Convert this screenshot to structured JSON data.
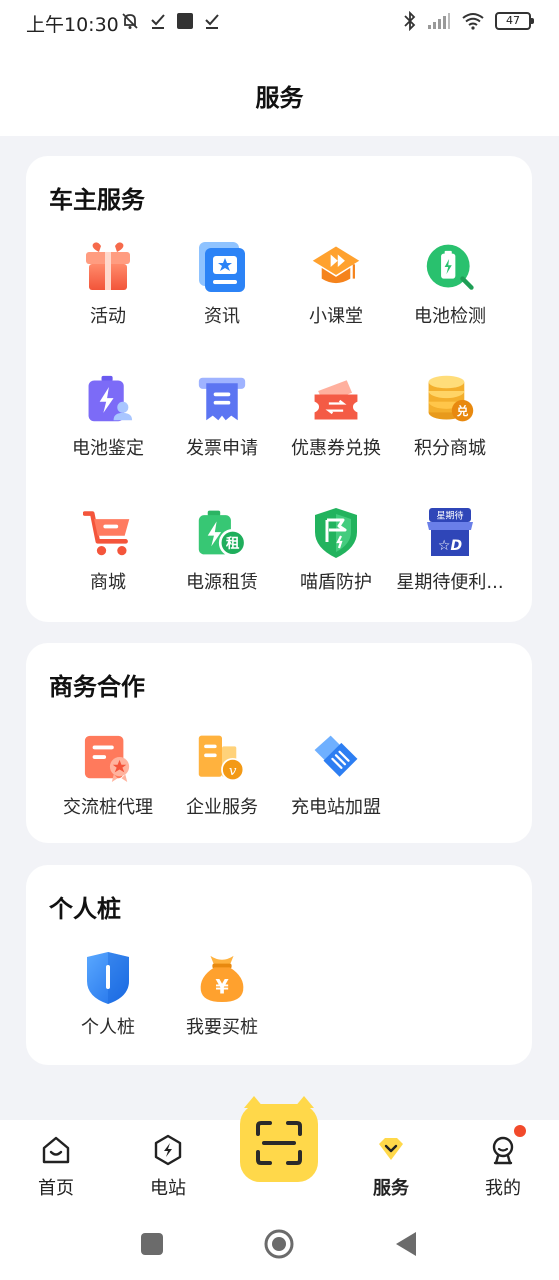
{
  "status_bar": {
    "time": "上午10:30",
    "battery": "47"
  },
  "header": {
    "title": "服务"
  },
  "owner_services": {
    "title": "车主服务",
    "items": [
      {
        "label": "活动",
        "icon": "gift-icon"
      },
      {
        "label": "资讯",
        "icon": "news-icon"
      },
      {
        "label": "小课堂",
        "icon": "classroom-icon"
      },
      {
        "label": "电池检测",
        "icon": "battery-check-icon"
      },
      {
        "label": "电池鉴定",
        "icon": "battery-appraisal-icon"
      },
      {
        "label": "发票申请",
        "icon": "invoice-icon"
      },
      {
        "label": "优惠券兑换",
        "icon": "coupon-icon"
      },
      {
        "label": "积分商城",
        "icon": "points-mall-icon"
      },
      {
        "label": "商城",
        "icon": "cart-icon"
      },
      {
        "label": "电源租赁",
        "icon": "battery-rent-icon"
      },
      {
        "label": "喵盾防护",
        "icon": "shield-protection-icon"
      },
      {
        "label": "星期待便利...",
        "icon": "convenience-store-icon"
      }
    ]
  },
  "business": {
    "title": "商务合作",
    "items": [
      {
        "label": "交流桩代理",
        "icon": "agent-certificate-icon"
      },
      {
        "label": "企业服务",
        "icon": "enterprise-icon"
      },
      {
        "label": "充电站加盟",
        "icon": "handshake-icon"
      }
    ]
  },
  "personal": {
    "title": "个人桩",
    "items": [
      {
        "label": "个人桩",
        "icon": "charging-pile-icon"
      },
      {
        "label": "我要买桩",
        "icon": "money-bag-icon"
      }
    ]
  },
  "bottom_nav": {
    "items": [
      {
        "label": "首页",
        "icon": "home-icon"
      },
      {
        "label": "电站",
        "icon": "station-icon"
      },
      {
        "label": "服务",
        "icon": "service-icon",
        "active": true
      },
      {
        "label": "我的",
        "icon": "profile-icon"
      }
    ],
    "scan_icon": "scan-icon"
  },
  "colors": {
    "accent": "#FFD84A",
    "page_bg": "#F2F3F7",
    "badge": "#F24A2B"
  }
}
